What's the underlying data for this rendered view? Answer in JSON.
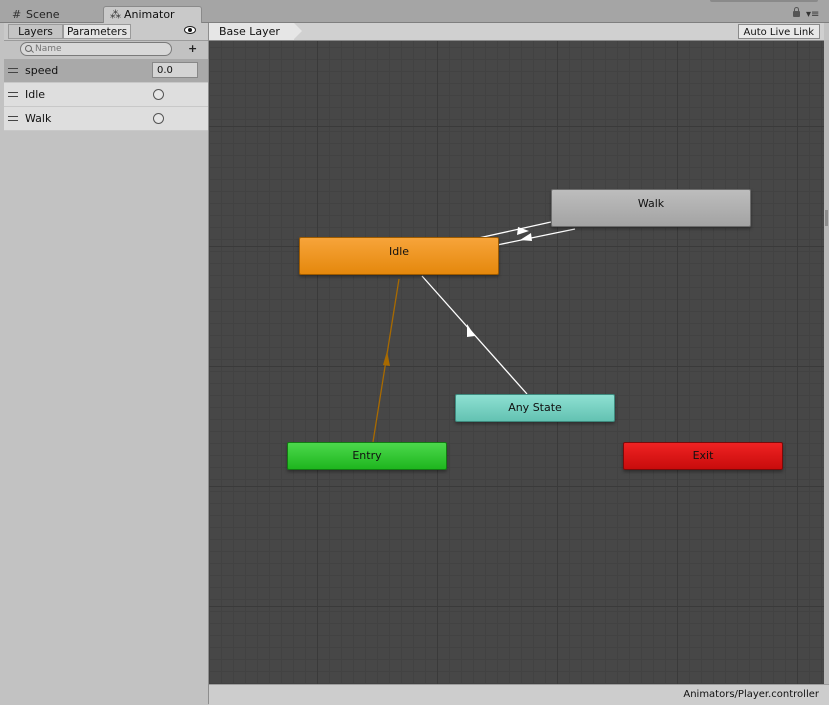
{
  "tabs": {
    "scene": {
      "label": "Scene",
      "icon": "hash-icon"
    },
    "animator": {
      "label": "Animator",
      "icon": "animator-icon"
    }
  },
  "left_panel": {
    "tab_layers": "Layers",
    "tab_parameters": "Parameters",
    "search_placeholder": "Name",
    "parameters": [
      {
        "name": "speed",
        "type": "float",
        "value": "0.0",
        "selected": true
      },
      {
        "name": "Idle",
        "type": "trigger",
        "selected": false
      },
      {
        "name": "Walk",
        "type": "trigger",
        "selected": false
      }
    ]
  },
  "graph": {
    "breadcrumb": "Base Layer",
    "auto_live_link": "Auto Live Link",
    "states": {
      "walk": {
        "label": "Walk",
        "color": "#b0b0b0"
      },
      "idle": {
        "label": "Idle",
        "color": "#f0961e"
      },
      "any_state": {
        "label": "Any State",
        "color": "#76d0c2"
      },
      "entry": {
        "label": "Entry",
        "color": "#2cc72c"
      },
      "exit": {
        "label": "Exit",
        "color": "#df1616"
      }
    },
    "transitions": [
      {
        "from": "Idle",
        "to": "Walk",
        "color": "#ffffff"
      },
      {
        "from": "Walk",
        "to": "Idle",
        "color": "#ffffff"
      },
      {
        "from": "Any State",
        "to": "Idle",
        "color": "#ffffff"
      },
      {
        "from": "Entry",
        "to": "Idle",
        "color": "#a86a00"
      }
    ]
  },
  "status": {
    "controller_path": "Animators/Player.controller"
  }
}
